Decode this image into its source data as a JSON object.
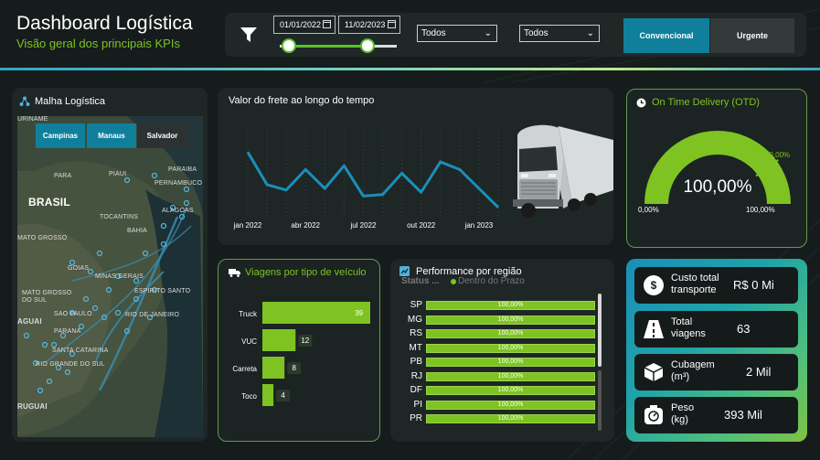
{
  "header": {
    "title": "Dashboard Logística",
    "subtitle": "Visão geral dos principais KPIs"
  },
  "filters": {
    "date_start": "01/01/2022",
    "date_end": "11/02/2023",
    "dropdown1": "Todos",
    "dropdown2": "Todos",
    "btn_convencional": "Convencional",
    "btn_urgente": "Urgente",
    "range_start": 0.08,
    "range_end": 0.75
  },
  "map": {
    "title": "Malha Logística",
    "buttons": [
      "Campinas",
      "Manaus",
      "Salvador"
    ],
    "labels": [
      "URINAME",
      "BRASIL",
      "PARA",
      "TOCANTINS",
      "BAHIA",
      "MATO GROSSO",
      "GOIAS",
      "MATO GROSSO DO SUL",
      "MINAS GERAIS",
      "SAO PAULO",
      "ESPIRITO SANTO",
      "RIO DE JANEIRO",
      "PARANA",
      "SANTA CATARINA",
      "RIO GRANDE DO SUL",
      "AGUAI",
      "RUGUAI",
      "PERNAMBUCO",
      "ALAGOAS",
      "PIAUI",
      "PARAIBA"
    ]
  },
  "freight": {
    "title": "Valor do frete ao longo do tempo",
    "x_ticks": [
      "jan 2022",
      "abr 2022",
      "jul 2022",
      "out 2022",
      "jan 2023"
    ]
  },
  "otd": {
    "title": "On Time Delivery (OTD)",
    "value": "100,00%",
    "min": "0,00%",
    "max": "100,00%",
    "target": "80,00%",
    "fraction": 1.0,
    "target_fraction": 0.8,
    "color": "#7ec322"
  },
  "vehicles": {
    "title": "Viagens por tipo de veículo",
    "categories": [
      "Truck",
      "VUC",
      "Carreta",
      "Toco"
    ],
    "values": [
      39,
      12,
      8,
      4
    ]
  },
  "regions": {
    "title": "Performance por região",
    "legend_status": "Status ...",
    "legend_item": "Dentro do Prazo",
    "rows": [
      {
        "label": "SP",
        "value": "100,00%"
      },
      {
        "label": "MG",
        "value": "100,00%"
      },
      {
        "label": "RS",
        "value": "100,00%"
      },
      {
        "label": "MT",
        "value": "100,00%"
      },
      {
        "label": "PB",
        "value": "100,00%"
      },
      {
        "label": "RJ",
        "value": "100,00%"
      },
      {
        "label": "DF",
        "value": "100,00%"
      },
      {
        "label": "PI",
        "value": "100,00%"
      },
      {
        "label": "PR",
        "value": "100,00%"
      }
    ]
  },
  "kpis": {
    "cost_label": "Custo total transporte",
    "cost_value": "R$ 0 Mi",
    "trips_label": "Total viagens",
    "trips_value": "63",
    "volume_label": "Cubagem (m³)",
    "volume_value": "2 Mil",
    "weight_label": "Peso (kg)",
    "weight_value": "393 Mil"
  },
  "chart_data": [
    {
      "type": "line",
      "title": "Valor do frete ao longo do tempo",
      "x": [
        "jan 2022",
        "fev 2022",
        "mar 2022",
        "abr 2022",
        "mai 2022",
        "jun 2022",
        "jul 2022",
        "ago 2022",
        "set 2022",
        "out 2022",
        "nov 2022",
        "dez 2022",
        "jan 2023",
        "fev 2023"
      ],
      "values": [
        78,
        35,
        28,
        55,
        30,
        60,
        20,
        22,
        50,
        25,
        65,
        55,
        30,
        5
      ],
      "ylim": [
        0,
        100
      ],
      "xlabel": "",
      "ylabel": ""
    },
    {
      "type": "bar",
      "title": "Viagens por tipo de veículo",
      "categories": [
        "Truck",
        "VUC",
        "Carreta",
        "Toco"
      ],
      "values": [
        39,
        12,
        8,
        4
      ]
    },
    {
      "type": "bar",
      "title": "Performance por região",
      "categories": [
        "SP",
        "MG",
        "RS",
        "MT",
        "PB",
        "RJ",
        "DF",
        "PI",
        "PR"
      ],
      "values": [
        100,
        100,
        100,
        100,
        100,
        100,
        100,
        100,
        100
      ]
    }
  ]
}
